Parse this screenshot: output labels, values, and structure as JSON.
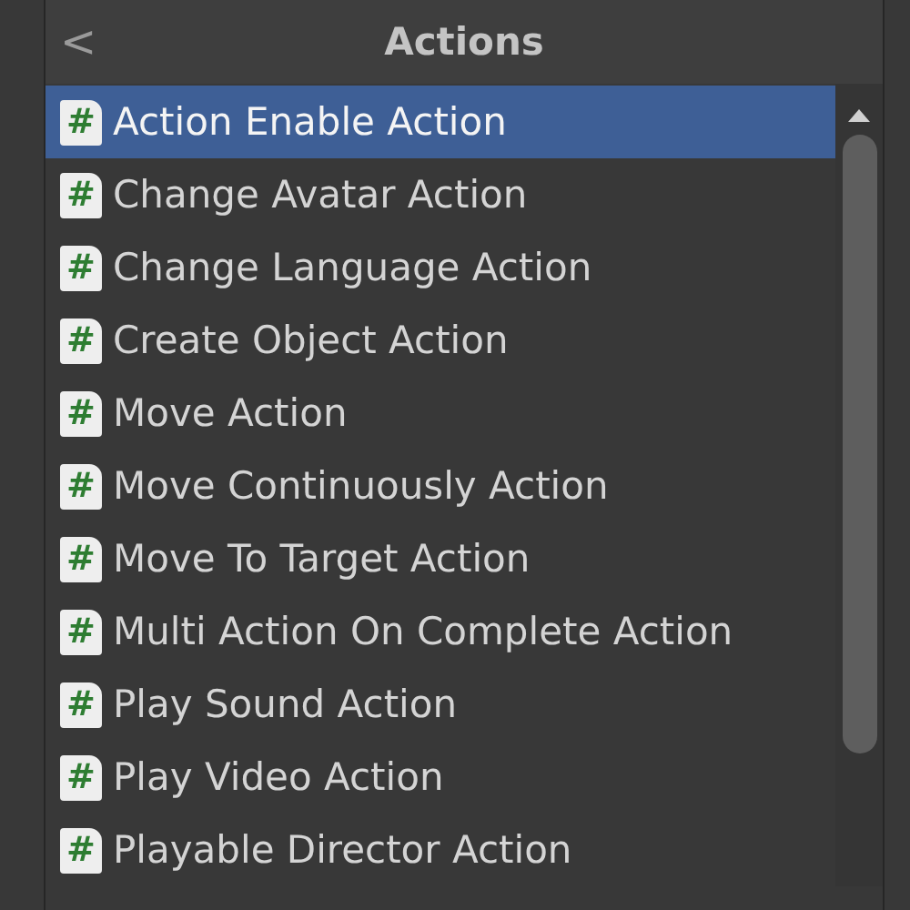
{
  "header": {
    "back": "<",
    "title": "Actions"
  },
  "items": [
    {
      "label": "Action Enable Action",
      "selected": true
    },
    {
      "label": "Change Avatar Action",
      "selected": false
    },
    {
      "label": "Change Language Action",
      "selected": false
    },
    {
      "label": "Create Object Action",
      "selected": false
    },
    {
      "label": "Move Action",
      "selected": false
    },
    {
      "label": "Move Continuously Action",
      "selected": false
    },
    {
      "label": "Move To Target Action",
      "selected": false
    },
    {
      "label": "Multi Action On Complete Action",
      "selected": false
    },
    {
      "label": "Play Sound Action",
      "selected": false
    },
    {
      "label": "Play Video Action",
      "selected": false
    },
    {
      "label": "Playable Director Action",
      "selected": false
    }
  ],
  "icon_glyph": "#"
}
